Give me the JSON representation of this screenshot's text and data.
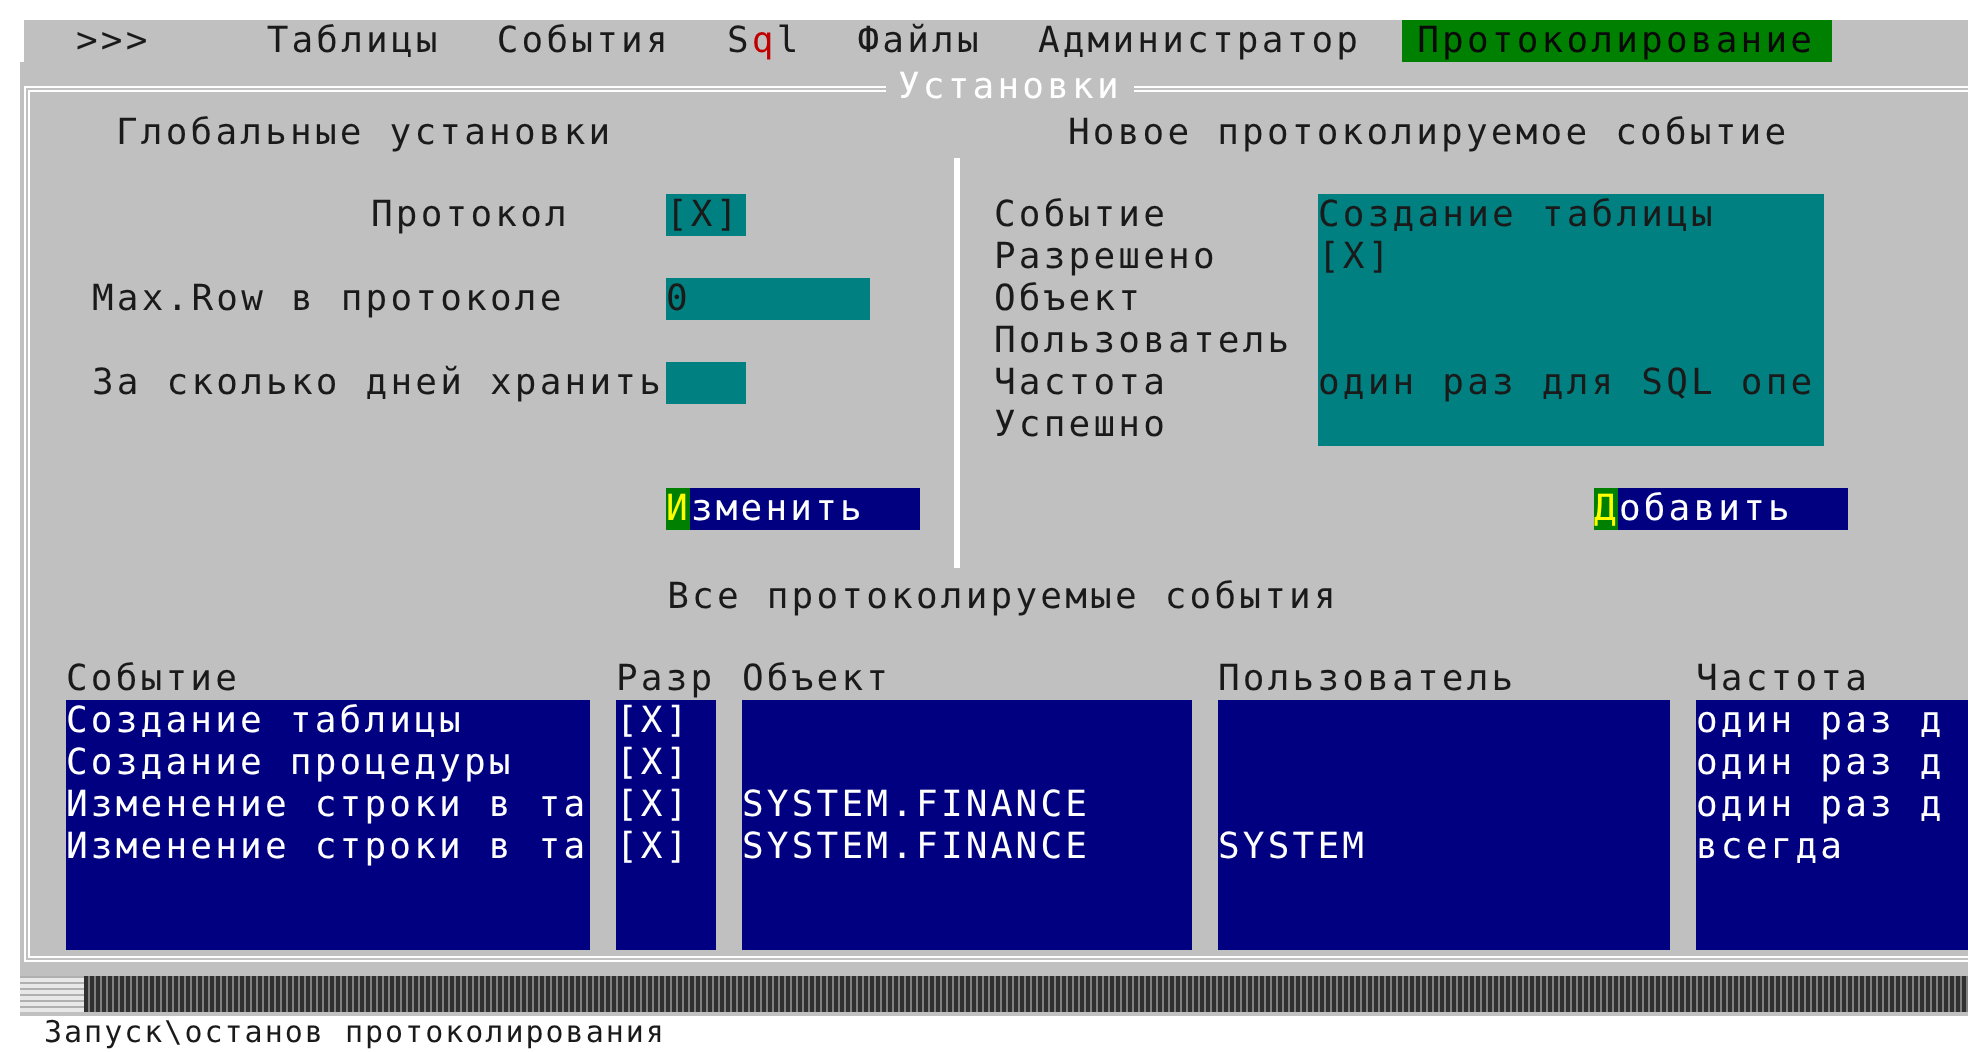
{
  "menu": [
    {
      "label": ">>>",
      "selected": false
    },
    {
      "label": "Таблицы",
      "selected": false
    },
    {
      "label": "События",
      "selected": false
    },
    {
      "label_start": "S",
      "hotkey": "q",
      "label_end": "l",
      "selected": false
    },
    {
      "label": "Файлы",
      "selected": false
    },
    {
      "label": "Администратор",
      "selected": false
    },
    {
      "label": "Протоколирование",
      "selected": true
    }
  ],
  "window": {
    "title": "Установки"
  },
  "global_settings": {
    "title": "Глобальные установки",
    "fields": [
      {
        "kind": "checkbox",
        "label": "Протокол",
        "value": "[X]"
      },
      {
        "kind": "wide",
        "label": "Max.Row в протоколе",
        "value": "0"
      },
      {
        "kind": "short",
        "label": "За сколько дней хранить"
      }
    ],
    "button": {
      "hotkey": "И",
      "label_end": "зменить"
    }
  },
  "new_event": {
    "title": "Новое протоколируемое событие",
    "fields": [
      {
        "label": "Событие",
        "value": "Создание таблицы"
      },
      {
        "label": "Разрешено",
        "value": "[X]"
      },
      {
        "label": "Объект"
      },
      {
        "label": "Пользователь"
      },
      {
        "label": "Частота",
        "value": "один раз для SQL опе"
      },
      {
        "label": "Успешно"
      }
    ],
    "button": {
      "hotkey": "Д",
      "label_end": "обавить"
    }
  },
  "events_table": {
    "title": "Все протоколируемые события",
    "columns": [
      "Событие",
      "Разр",
      "Объект",
      "Пользователь",
      "Частота"
    ],
    "rows": [
      [
        "Создание таблицы",
        "[X]",
        "",
        "",
        "один раз д"
      ],
      [
        "Создание процедуры",
        "[X]",
        "",
        "",
        "один раз д"
      ],
      [
        "Изменение строки в та",
        "[X]",
        "SYSTEM.FINANCE",
        "",
        "один раз д"
      ],
      [
        "Изменение строки в та",
        "[X]",
        "SYSTEM.FINANCE",
        "SYSTEM",
        "всегда"
      ]
    ]
  },
  "status_bar": "Запуск\\останов протоколирования"
}
